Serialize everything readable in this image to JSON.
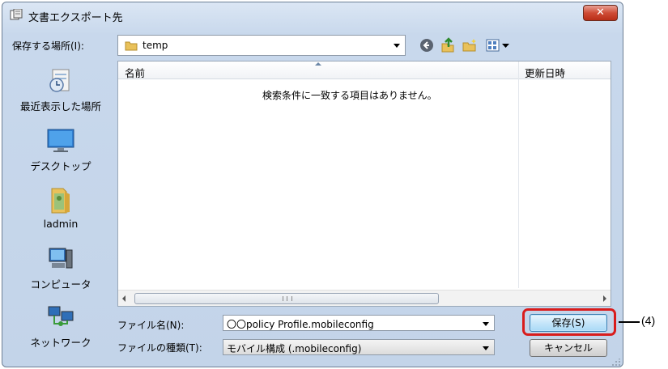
{
  "window": {
    "title": "文書エクスポート先",
    "close_glyph": "✕"
  },
  "toolbar": {
    "save_in_label": "保存する場所(I):",
    "path_value": "temp"
  },
  "places": [
    {
      "label": "最近表示した場所",
      "icon": "recent-places-icon"
    },
    {
      "label": "デスクトップ",
      "icon": "desktop-icon"
    },
    {
      "label": "ladmin",
      "icon": "user-folder-icon"
    },
    {
      "label": "コンピュータ",
      "icon": "computer-icon"
    },
    {
      "label": "ネットワーク",
      "icon": "network-icon"
    }
  ],
  "file_list": {
    "columns": [
      "名前",
      "更新日時"
    ],
    "empty_message": "検索条件に一致する項目はありません。",
    "scroll_grip": "III"
  },
  "form": {
    "filename_label": "ファイル名(N):",
    "filename_value": "〇〇policy Profile.mobileconfig",
    "filetype_label": "ファイルの種類(T):",
    "filetype_value": "モバイル構成 (.mobileconfig)"
  },
  "buttons": {
    "save": "保存(S)",
    "cancel": "キャンセル"
  },
  "annotation": {
    "label": "(4)"
  },
  "colors": {
    "dialog_bg": "#c8d8ec",
    "highlight": "#d91c1c",
    "close_button": "#cf4c36"
  }
}
